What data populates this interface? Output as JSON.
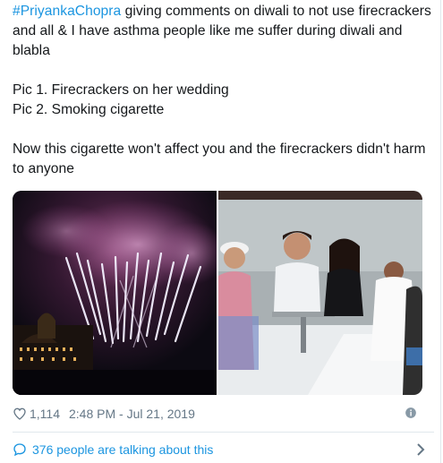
{
  "tweet": {
    "hashtag": "#PriyankaChopra",
    "line1_rest": " giving comments on diwali to not use firecrackers and all & I have asthma people like me suffer during diwali and blabla",
    "pic1": "Pic 1. Firecrackers on her wedding",
    "pic2": "Pic 2. Smoking cigarette",
    "closing": "Now this cigarette won't affect you and the firecrackers didn't harm to anyone"
  },
  "media": {
    "photos": [
      {
        "icon": "fireworks-photo"
      },
      {
        "icon": "yacht-photo"
      }
    ]
  },
  "meta": {
    "like_count": "1,114",
    "timestamp": "2:48 PM - Jul 21, 2019",
    "heart_icon": "heart-icon",
    "info_icon": "info-icon"
  },
  "conversation": {
    "label": "376 people are talking about this",
    "icon": "speech-bubble-icon",
    "chevron": "chevron-right-icon"
  },
  "colors": {
    "link": "#1b95e0",
    "meta": "#657786",
    "text": "#14171a"
  }
}
